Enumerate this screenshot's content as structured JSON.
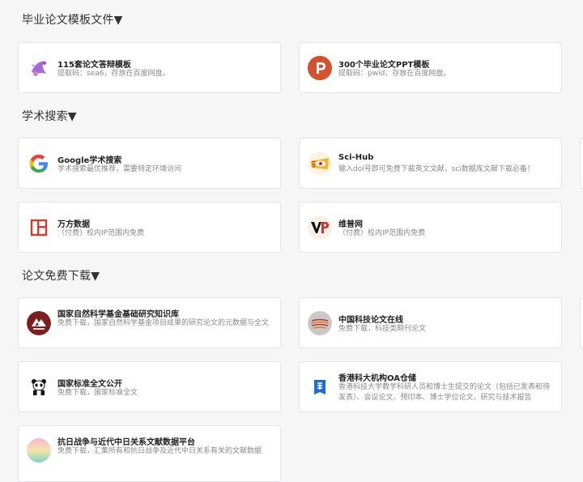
{
  "sections": [
    {
      "title": "毕业论文模板文件▼"
    },
    {
      "title": "学术搜索▼"
    },
    {
      "title": "论文免费下载▼"
    }
  ],
  "cards": [
    {
      "title": "115套论文答辩模板",
      "desc": "提取码：sea6，存放在百度网盘。",
      "icon": "purple-splash-icon"
    },
    {
      "title": "300个毕业论文PPT模板",
      "desc": "提取码：pwid，存放在百度网盘。",
      "icon": "powerpoint-icon"
    },
    {
      "title": "Google学术搜索",
      "desc": "学术搜索最优推荐，需要特定环境访问",
      "icon": "google-icon"
    },
    {
      "title": "Sci-Hub",
      "desc": "输入doi号即可免费下载英文文献，sci数据库文献下载必备！",
      "icon": "sci-hub-icon"
    },
    {
      "title": "万方数据",
      "desc": "（付费）校内IP范围内免费",
      "icon": "wanfang-icon"
    },
    {
      "title": "维普网",
      "desc": "（付费）校内IP范围内免费",
      "icon": "vip-icon"
    },
    {
      "title": "国家自然科学基金基础研究知识库",
      "desc": "免费下载，国家自然科学基金项目成果的研究论文的元数据与全文",
      "icon": "nsfc-icon"
    },
    {
      "title": "中国科技论文在线",
      "desc": "免费下载，科技类期刊论文",
      "icon": "paper-online-icon"
    },
    {
      "title": "国家标准全文公开",
      "desc": "免费下载，国家标准全文",
      "icon": "panda-icon"
    },
    {
      "title": "香港科大机构OA仓储",
      "desc": "香港科技大学教学科研人员和博士生提交的论文（包括已发表和待发表）、会议论文、预印本、博士学位论文、研究与技术报告",
      "icon": "hkust-icon"
    },
    {
      "title": "抗日战争与近代中日关系文献数据平台",
      "desc": "免费下载，汇集所有和抗日战争及近代中日关系有关的文献数据",
      "icon": "gradient-circle-icon"
    }
  ],
  "colors": {
    "background": "#f6f6f7",
    "card_border": "#e4e4e6",
    "title": "#222222",
    "desc": "#888888",
    "powerpoint_orange": "#d35230",
    "nsfc_red": "#7a1f1f"
  }
}
